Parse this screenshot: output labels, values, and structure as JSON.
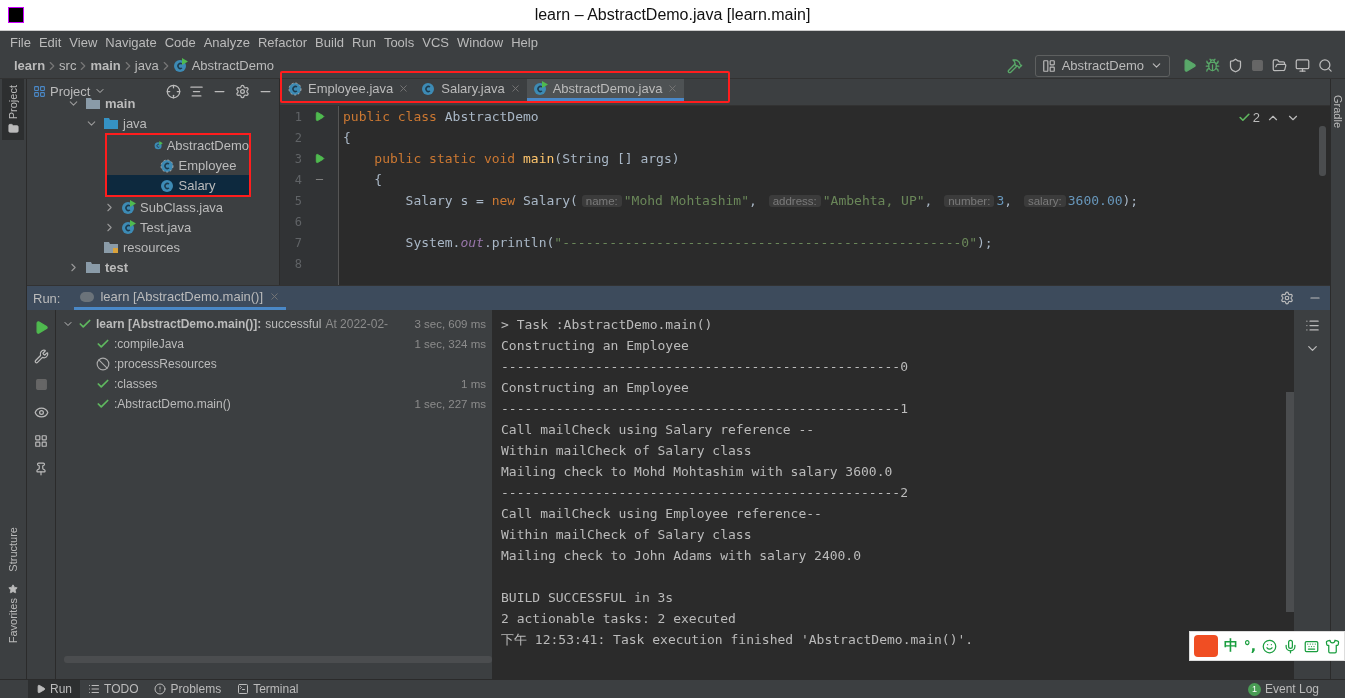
{
  "window": {
    "title": "learn – AbstractDemo.java [learn.main]"
  },
  "menu": [
    "File",
    "Edit",
    "View",
    "Navigate",
    "Code",
    "Analyze",
    "Refactor",
    "Build",
    "Run",
    "Tools",
    "VCS",
    "Window",
    "Help"
  ],
  "breadcrumbs": [
    {
      "label": "learn",
      "bold": true,
      "kind": "folder"
    },
    {
      "label": "src",
      "bold": false,
      "kind": "folder"
    },
    {
      "label": "main",
      "bold": true,
      "kind": "folder"
    },
    {
      "label": "java",
      "bold": false,
      "kind": "folder"
    },
    {
      "label": "AbstractDemo",
      "bold": false,
      "kind": "runnable-class"
    }
  ],
  "toolbar": {
    "run_config": "AbstractDemo"
  },
  "left_stripe": [
    {
      "label": "Project",
      "selected": true
    },
    {
      "label": "Structure",
      "selected": false
    },
    {
      "label": "Favorites",
      "selected": false
    }
  ],
  "right_stripe": [
    {
      "label": "Gradle"
    }
  ],
  "project_panel": {
    "title": "Project",
    "tree": [
      {
        "label": "main",
        "kind": "folder",
        "bold": true,
        "expanded": true,
        "selected": false,
        "framed": false,
        "children": [
          {
            "label": "java",
            "kind": "source-folder",
            "bold": false,
            "expanded": true,
            "selected": false,
            "framed": false,
            "children": [
              {
                "label": "AbstractDemo",
                "kind": "runnable-class",
                "bold": false,
                "selected": false,
                "framed": true
              },
              {
                "label": "Employee",
                "kind": "abstract-class",
                "bold": false,
                "selected": false,
                "framed": true
              },
              {
                "label": "Salary",
                "kind": "class",
                "bold": false,
                "selected": true,
                "framed": true
              },
              {
                "label": "SubClass.java",
                "kind": "runnable-class",
                "bold": false,
                "expanded": false,
                "selected": false,
                "framed": false
              },
              {
                "label": "Test.java",
                "kind": "runnable-class",
                "bold": false,
                "expanded": false,
                "selected": false,
                "framed": false
              }
            ]
          },
          {
            "label": "resources",
            "kind": "resources-folder",
            "bold": false,
            "selected": false,
            "framed": false
          }
        ]
      },
      {
        "label": "test",
        "kind": "folder",
        "bold": true,
        "expanded": false,
        "selected": false,
        "framed": false
      }
    ]
  },
  "editor": {
    "tabs_framed": true,
    "tabs": [
      {
        "label": "Employee.java",
        "kind": "abstract-class",
        "selected": false
      },
      {
        "label": "Salary.java",
        "kind": "class",
        "selected": false
      },
      {
        "label": "AbstractDemo.java",
        "kind": "runnable-class",
        "selected": true
      }
    ],
    "inspections": "2",
    "lines": [
      {
        "number": "1",
        "run_marker": true,
        "fold_marker": false,
        "segments": [
          {
            "kind": "keyword",
            "text": "public class "
          },
          {
            "kind": "plain",
            "text": "AbstractDemo"
          }
        ]
      },
      {
        "number": "2",
        "run_marker": false,
        "fold_marker": false,
        "segments": [
          {
            "kind": "plain",
            "text": "{"
          }
        ]
      },
      {
        "number": "3",
        "run_marker": true,
        "fold_marker": false,
        "segments": [
          {
            "kind": "keyword",
            "text": "    public static void "
          },
          {
            "kind": "method",
            "text": "main"
          },
          {
            "kind": "plain",
            "text": "(String [] args)"
          }
        ]
      },
      {
        "number": "4",
        "run_marker": false,
        "fold_marker": true,
        "segments": [
          {
            "kind": "plain",
            "text": "    {"
          }
        ]
      },
      {
        "number": "5",
        "run_marker": false,
        "fold_marker": false,
        "segments": [
          {
            "kind": "plain",
            "text": "        Salary s = "
          },
          {
            "kind": "keyword",
            "text": "new "
          },
          {
            "kind": "plain",
            "text": "Salary("
          },
          {
            "kind": "hint",
            "text": "name:"
          },
          {
            "kind": "string",
            "text": "\"Mohd Mohtashim\""
          },
          {
            "kind": "plain",
            "text": ", "
          },
          {
            "kind": "hint",
            "text": "address:"
          },
          {
            "kind": "string",
            "text": "\"Ambehta, UP\""
          },
          {
            "kind": "plain",
            "text": ", "
          },
          {
            "kind": "hint",
            "text": "number:"
          },
          {
            "kind": "number",
            "text": "3"
          },
          {
            "kind": "plain",
            "text": ", "
          },
          {
            "kind": "hint",
            "text": "salary:"
          },
          {
            "kind": "number",
            "text": "3600.00"
          },
          {
            "kind": "plain",
            "text": ");"
          }
        ]
      },
      {
        "number": "6",
        "run_marker": false,
        "fold_marker": false
      },
      {
        "number": "7",
        "run_marker": false,
        "fold_marker": false,
        "segments": [
          {
            "kind": "plain",
            "text": "        System."
          },
          {
            "kind": "static",
            "text": "out"
          },
          {
            "kind": "plain",
            "text": ".println("
          },
          {
            "kind": "string",
            "text": "\"---------------------------------------------------0\""
          },
          {
            "kind": "plain",
            "text": ");"
          }
        ]
      },
      {
        "number": "8",
        "run_marker": false,
        "fold_marker": false
      }
    ]
  },
  "run_panel": {
    "label": "Run:",
    "tab": "learn [AbstractDemo.main()]",
    "tree": [
      {
        "label": "learn [AbstractDemo.main()]:",
        "status": "successful",
        "started": "At 2022-02-",
        "time": "3 sec, 609 ms",
        "kind": "success",
        "expanded": true,
        "children": [
          {
            "label": ":compileJava",
            "time": "1 sec, 324 ms",
            "kind": "success"
          },
          {
            "label": ":processResources",
            "kind": "skipped"
          },
          {
            "label": ":classes",
            "time": "1 ms",
            "kind": "success"
          },
          {
            "label": ":AbstractDemo.main()",
            "time": "1 sec, 227 ms",
            "kind": "success"
          }
        ]
      }
    ],
    "output_blocks": [
      [
        "> Task :AbstractDemo.main()",
        "Constructing an Employee",
        "---------------------------------------------------0",
        "Constructing an Employee",
        "---------------------------------------------------1",
        "Call mailCheck using Salary reference --",
        "Within mailCheck of Salary class",
        "Mailing check to Mohd Mohtashim with salary 3600.0",
        "---------------------------------------------------2",
        "Call mailCheck using Employee reference--",
        "Within mailCheck of Salary class",
        "Mailing check to John Adams with salary 2400.0"
      ],
      [
        "BUILD SUCCESSFUL in 3s",
        "2 actionable tasks: 2 executed",
        "下午 12:53:41: Task execution finished 'AbstractDemo.main()'."
      ]
    ]
  },
  "bottom_bar": {
    "tabs": [
      {
        "label": "Run",
        "kind": "run",
        "selected": true
      },
      {
        "label": "TODO",
        "kind": "todo",
        "selected": false
      },
      {
        "label": "Problems",
        "kind": "problems",
        "selected": false
      },
      {
        "label": "Terminal",
        "kind": "terminal",
        "selected": false
      }
    ],
    "event_log": {
      "label": "Event Log",
      "count": "1"
    }
  },
  "ime_bar": {
    "labels": [
      "中",
      "°,"
    ]
  }
}
